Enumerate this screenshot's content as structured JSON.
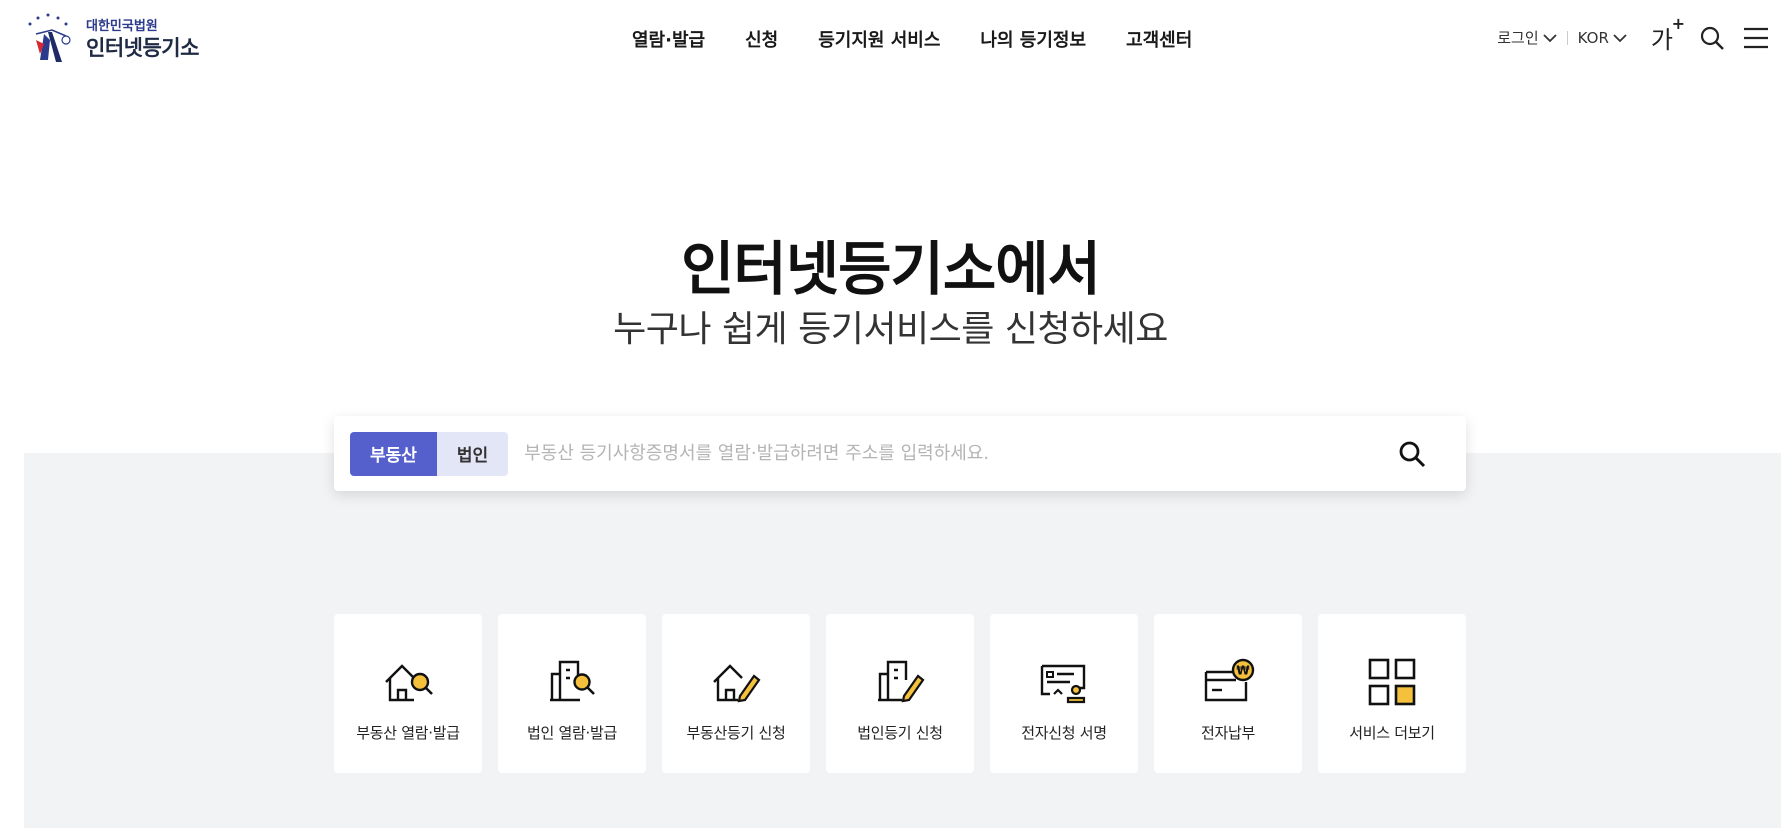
{
  "header": {
    "logo_sub": "대한민국법원",
    "logo_main": "인터넷등기소",
    "nav": [
      "열람·발급",
      "신청",
      "등기지원 서비스",
      "나의 등기정보",
      "고객센터"
    ],
    "login_label": "로그인",
    "lang_label": "KOR",
    "font_size_label": "가",
    "font_size_plus": "+"
  },
  "hero": {
    "title": "인터넷등기소에서",
    "subtitle": "누구나 쉽게 등기서비스를 신청하세요"
  },
  "search": {
    "tab_real_estate": "부동산",
    "tab_corporation": "법인",
    "placeholder": "부동산 등기사항증명서를 열람·발급하려면 주소를 입력하세요."
  },
  "quick_menu": [
    {
      "label": "부동산 열람·발급",
      "icon": "house-search-icon"
    },
    {
      "label": "법인 열람·발급",
      "icon": "building-search-icon"
    },
    {
      "label": "부동산등기 신청",
      "icon": "house-pen-icon"
    },
    {
      "label": "법인등기 신청",
      "icon": "building-pen-icon"
    },
    {
      "label": "전자신청 서명",
      "icon": "e-sign-icon"
    },
    {
      "label": "전자납부",
      "icon": "e-payment-icon"
    },
    {
      "label": "서비스 더보기",
      "icon": "grid-more-icon"
    }
  ],
  "colors": {
    "accent": "#5560cc",
    "accent_light": "#e3e6f6",
    "highlight": "#f5c13d",
    "section_bg": "#f2f3f5"
  }
}
